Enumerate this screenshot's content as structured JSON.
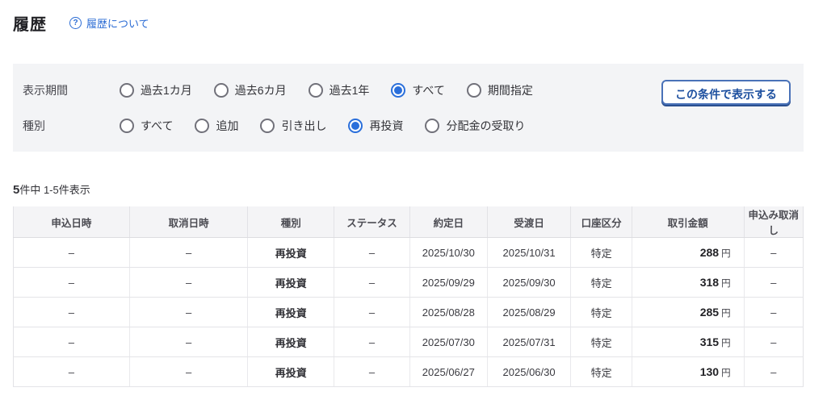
{
  "page": {
    "title": "履歴",
    "about_link_label": "履歴について",
    "question_icon": "?"
  },
  "colors": {
    "accent_blue": "#2a6fdb",
    "link_blue": "#2a6bd4",
    "button_text_blue": "#1c4f9f",
    "panel_bg": "#f3f4f6",
    "table_header_bg": "#f4f4f6"
  },
  "filters": {
    "period": {
      "label": "表示期間",
      "selected": "すべて",
      "options": [
        {
          "label": "過去1カ月",
          "selected": false
        },
        {
          "label": "過去6カ月",
          "selected": false
        },
        {
          "label": "過去1年",
          "selected": false
        },
        {
          "label": "すべて",
          "selected": true
        },
        {
          "label": "期間指定",
          "selected": false
        }
      ]
    },
    "type": {
      "label": "種別",
      "selected": "再投資",
      "options": [
        {
          "label": "すべて",
          "selected": false
        },
        {
          "label": "追加",
          "selected": false
        },
        {
          "label": "引き出し",
          "selected": false
        },
        {
          "label": "再投資",
          "selected": true
        },
        {
          "label": "分配金の受取り",
          "selected": false
        }
      ]
    },
    "apply_button_label": "この条件で表示する"
  },
  "summary": {
    "total": "5",
    "suffix": "件中 1-5件表示"
  },
  "table": {
    "headers": [
      "申込日時",
      "取消日時",
      "種別",
      "ステータス",
      "約定日",
      "受渡日",
      "口座区分",
      "取引金額",
      "申込み取消し"
    ],
    "rows": [
      {
        "apply_datetime": "–",
        "cancel_datetime": "–",
        "type": "再投資",
        "status": "–",
        "contract_date": "2025/10/30",
        "delivery_date": "2025/10/31",
        "account": "特定",
        "amount": "288",
        "currency": "円",
        "cancel_action": "–"
      },
      {
        "apply_datetime": "–",
        "cancel_datetime": "–",
        "type": "再投資",
        "status": "–",
        "contract_date": "2025/09/29",
        "delivery_date": "2025/09/30",
        "account": "特定",
        "amount": "318",
        "currency": "円",
        "cancel_action": "–"
      },
      {
        "apply_datetime": "–",
        "cancel_datetime": "–",
        "type": "再投資",
        "status": "–",
        "contract_date": "2025/08/28",
        "delivery_date": "2025/08/29",
        "account": "特定",
        "amount": "285",
        "currency": "円",
        "cancel_action": "–"
      },
      {
        "apply_datetime": "–",
        "cancel_datetime": "–",
        "type": "再投資",
        "status": "–",
        "contract_date": "2025/07/30",
        "delivery_date": "2025/07/31",
        "account": "特定",
        "amount": "315",
        "currency": "円",
        "cancel_action": "–"
      },
      {
        "apply_datetime": "–",
        "cancel_datetime": "–",
        "type": "再投資",
        "status": "–",
        "contract_date": "2025/06/27",
        "delivery_date": "2025/06/30",
        "account": "特定",
        "amount": "130",
        "currency": "円",
        "cancel_action": "–"
      }
    ]
  }
}
